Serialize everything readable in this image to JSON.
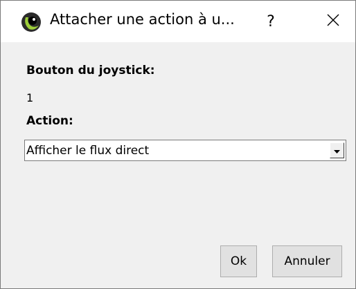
{
  "window": {
    "title": "Attacher une action à u...",
    "app_icon": "camera-eye-icon",
    "help_label": "?",
    "close_icon": "close-icon"
  },
  "form": {
    "joystick_label": "Bouton du joystick:",
    "joystick_value": "1",
    "action_label": "Action:",
    "action_selected": "Afficher le flux direct",
    "dropdown_icon": "chevron-down-icon"
  },
  "buttons": {
    "ok_label": "Ok",
    "cancel_label": "Annuler"
  },
  "colors": {
    "title_background": "#ffffff",
    "body_background": "#f0f0f0",
    "button_background": "#e1e1e1",
    "border": "#7a7a7a"
  }
}
